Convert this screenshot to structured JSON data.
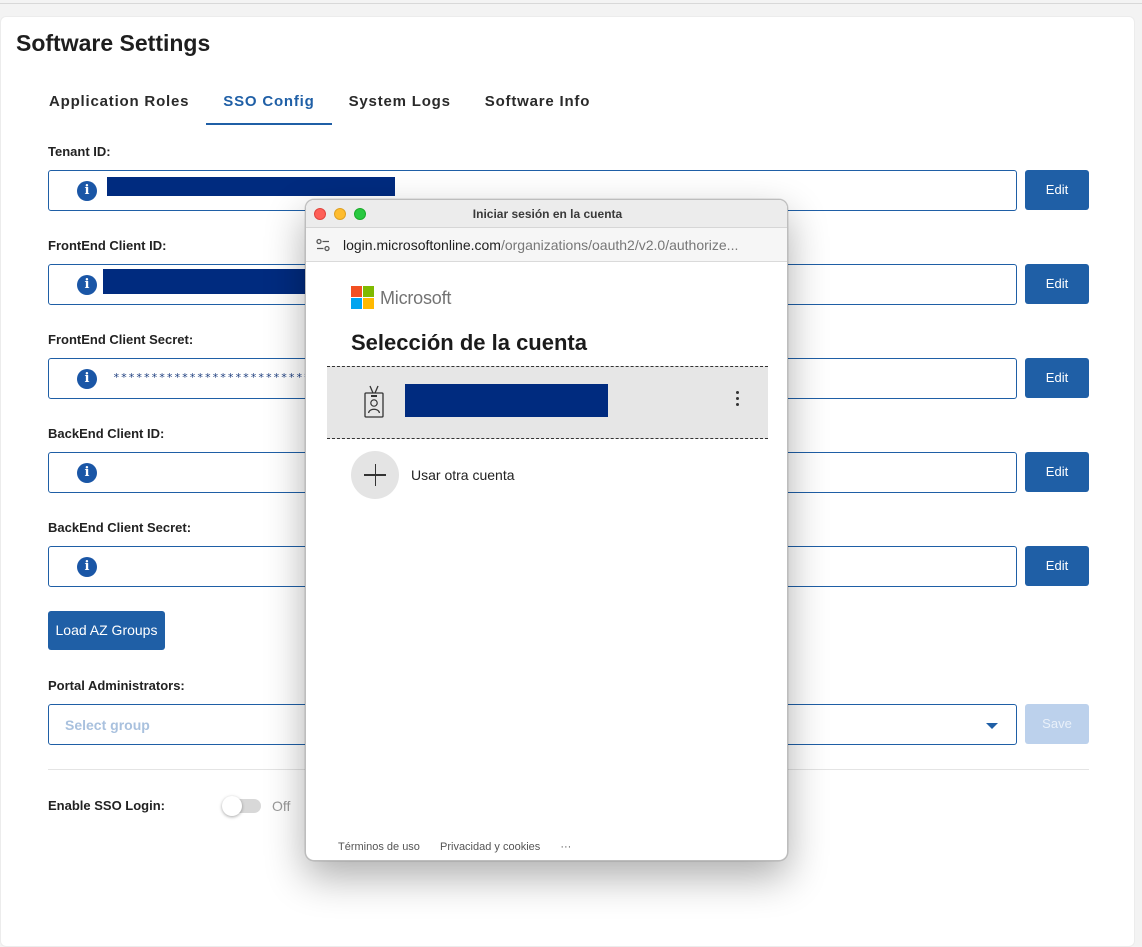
{
  "page": {
    "title": "Software Settings"
  },
  "tabs": [
    {
      "label": "Application Roles",
      "active": false
    },
    {
      "label": "SSO Config",
      "active": true
    },
    {
      "label": "System Logs",
      "active": false
    },
    {
      "label": "Software Info",
      "active": false
    }
  ],
  "fields": {
    "tenant_id": {
      "label": "Tenant ID:",
      "value": ""
    },
    "frontend_client_id": {
      "label": "FrontEnd Client ID:",
      "value": ""
    },
    "frontend_client_secret": {
      "label": "FrontEnd Client Secret:",
      "value": "**********************************"
    },
    "backend_client_id": {
      "label": "BackEnd Client ID:",
      "value": ""
    },
    "backend_client_secret": {
      "label": "BackEnd Client Secret:",
      "value": ""
    }
  },
  "buttons": {
    "edit": "Edit",
    "load_groups": "Load AZ Groups",
    "save": "Save"
  },
  "portal_admins": {
    "label": "Portal Administrators:",
    "placeholder": "Select group"
  },
  "sso_login": {
    "label": "Enable SSO Login:",
    "state": "Off"
  },
  "icons": {
    "info": "i"
  },
  "popup": {
    "window_title": "Iniciar sesión en la cuenta",
    "url_domain": "login.microsoftonline.com",
    "url_path": "/organizations/oauth2/v2.0/authorize...",
    "brand": "Microsoft",
    "heading": "Selección de la cuenta",
    "other_account": "Usar otra cuenta",
    "footer": {
      "terms": "Términos de uso",
      "privacy": "Privacidad y cookies",
      "more": "···"
    }
  },
  "colors": {
    "accent": "#1f5fa6",
    "redaction": "#002b7f",
    "ms_red": "#f25022",
    "ms_green": "#7fba00",
    "ms_blue": "#00a4ef",
    "ms_yellow": "#ffb900"
  }
}
